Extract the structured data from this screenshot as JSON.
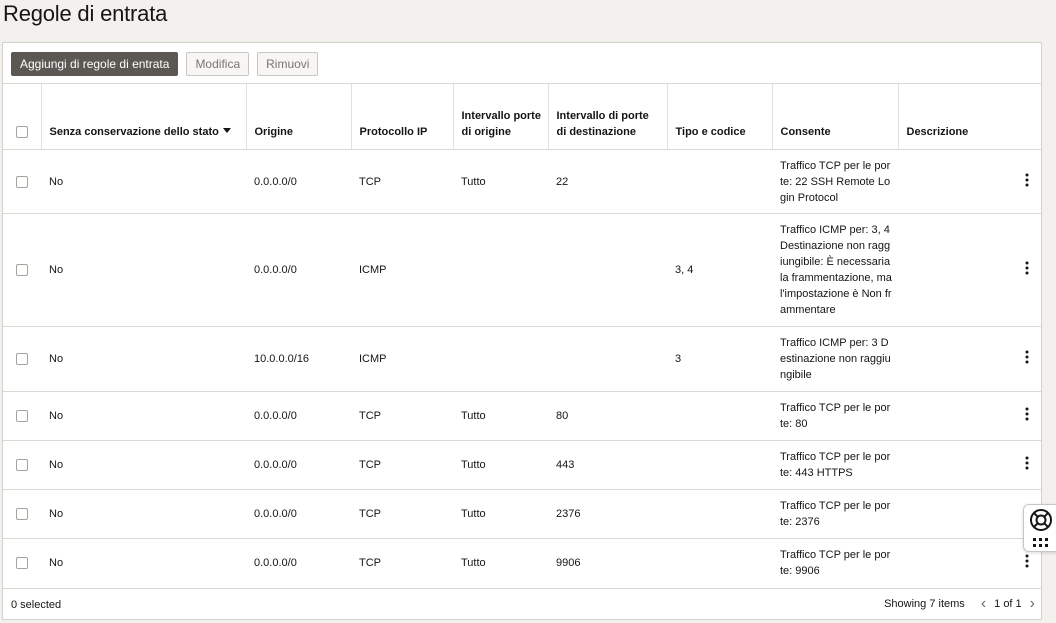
{
  "page": {
    "title": "Regole di entrata"
  },
  "toolbar": {
    "add_label": "Aggiungi di regole di entrata",
    "edit_label": "Modifica",
    "remove_label": "Rimuovi"
  },
  "table": {
    "headers": {
      "stateless": "Senza conservazione dello stato",
      "source": "Origine",
      "protocol": "Protocollo IP",
      "source_port": "Intervallo porte di origine",
      "dest_port": "Intervallo di porte di destinazione",
      "type_code": "Tipo e codice",
      "allows": "Consente",
      "description": "Descrizione"
    },
    "rows": [
      {
        "stateless": "No",
        "source": "0.0.0.0/0",
        "protocol": "TCP",
        "source_port": "Tutto",
        "dest_port": "22",
        "type_code": "",
        "allows": "Traffico TCP per le porte: 22 SSH Remote Login Protocol",
        "description": ""
      },
      {
        "stateless": "No",
        "source": "0.0.0.0/0",
        "protocol": "ICMP",
        "source_port": "",
        "dest_port": "",
        "type_code": "3, 4",
        "allows": "Traffico ICMP per: 3, 4 Destinazione non raggiungibile: È necessaria la frammentazione, ma l'impostazione è Non frammentare",
        "description": ""
      },
      {
        "stateless": "No",
        "source": "10.0.0.0/16",
        "protocol": "ICMP",
        "source_port": "",
        "dest_port": "",
        "type_code": "3",
        "allows": "Traffico ICMP per: 3 Destinazione non raggiungibile",
        "description": ""
      },
      {
        "stateless": "No",
        "source": "0.0.0.0/0",
        "protocol": "TCP",
        "source_port": "Tutto",
        "dest_port": "80",
        "type_code": "",
        "allows": "Traffico TCP per le porte: 80",
        "description": ""
      },
      {
        "stateless": "No",
        "source": "0.0.0.0/0",
        "protocol": "TCP",
        "source_port": "Tutto",
        "dest_port": "443",
        "type_code": "",
        "allows": "Traffico TCP per le porte: 443 HTTPS",
        "description": ""
      },
      {
        "stateless": "No",
        "source": "0.0.0.0/0",
        "protocol": "TCP",
        "source_port": "Tutto",
        "dest_port": "2376",
        "type_code": "",
        "allows": "Traffico TCP per le porte: 2376",
        "description": ""
      },
      {
        "stateless": "No",
        "source": "0.0.0.0/0",
        "protocol": "TCP",
        "source_port": "Tutto",
        "dest_port": "9906",
        "type_code": "",
        "allows": "Traffico TCP per le porte: 9906",
        "description": ""
      }
    ]
  },
  "footer": {
    "selected": "0 selected",
    "showing": "Showing 7 items",
    "page_info": "1 of 1"
  },
  "icons": {
    "row_actions": "kebab-menu-icon",
    "help": "lifebuoy-icon",
    "apps": "grid-icon",
    "prev": "chevron-left-icon",
    "next": "chevron-right-icon"
  }
}
